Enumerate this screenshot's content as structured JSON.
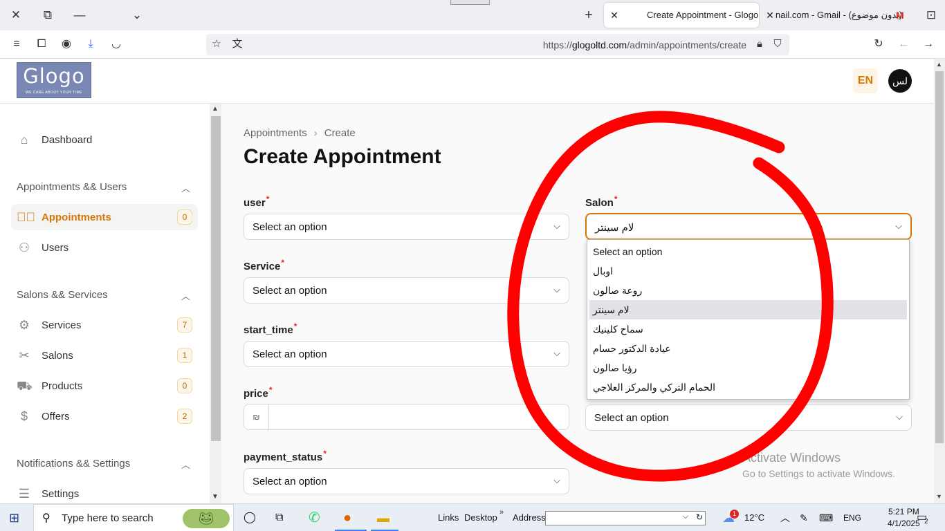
{
  "browser": {
    "tabs": [
      {
        "title": "Create Appointment - Glogo",
        "active": true
      },
      {
        "title": "nail.com - Gmail - (بدون موضوع)",
        "active": false
      }
    ],
    "url_prefix": "https://",
    "url_domain": "glogoltd.com",
    "url_path": "/admin/appointments/create"
  },
  "header": {
    "logo_text": "Glogo",
    "logo_tagline": "WE CARE ABOUT YOUR TIME",
    "lang": "EN",
    "avatar_initials": "لس"
  },
  "sidebar": {
    "dashboard": "Dashboard",
    "groups": [
      {
        "label": "Appointments && Users"
      },
      {
        "label": "Salons && Services"
      },
      {
        "label": "Notifications && Settings"
      }
    ],
    "items": [
      {
        "label": "Appointments",
        "badge": "0"
      },
      {
        "label": "Users"
      },
      {
        "label": "Services",
        "badge": "7"
      },
      {
        "label": "Salons",
        "badge": "1"
      },
      {
        "label": "Products",
        "badge": "0"
      },
      {
        "label": "Offers",
        "badge": "2"
      },
      {
        "label": "Settings"
      }
    ]
  },
  "main": {
    "breadcrumb": [
      "Appointments",
      "Create"
    ],
    "title": "Create Appointment",
    "fields": {
      "user": {
        "label": "user",
        "value": "Select an option"
      },
      "service": {
        "label": "Service",
        "value": "Select an option"
      },
      "start_time": {
        "label": "start_time",
        "value": "Select an option"
      },
      "price": {
        "label": "price",
        "currency": "₪",
        "value": ""
      },
      "payment_status": {
        "label": "payment_status",
        "value": "Select an option"
      },
      "salon": {
        "label": "Salon",
        "value": "لام سينتر"
      },
      "other": {
        "value": "Select an option"
      }
    },
    "salon_options": [
      "Select an option",
      "اوبال",
      "روعة صالون",
      "لام سينتر",
      "سماح كلينيك",
      "عيادة الدكتور حسام",
      "رؤيا صالون",
      "الحمام التركي والمركز العلاجي"
    ],
    "selected_option_index": 3
  },
  "watermark": {
    "line1": "Activate Windows",
    "line2": "Go to Settings to activate Windows."
  },
  "taskbar": {
    "search_placeholder": "Type here to search",
    "links": "Links",
    "desktop": "Desktop",
    "address": "Address",
    "weather_badge": "1",
    "temperature": "12°C",
    "language": "ENG",
    "time": "5:21 PM",
    "date": "4/1/2025",
    "notification_count": "2"
  },
  "colors": {
    "accent": "#d97706",
    "annotation": "#ff0000",
    "required": "#dc2626"
  }
}
